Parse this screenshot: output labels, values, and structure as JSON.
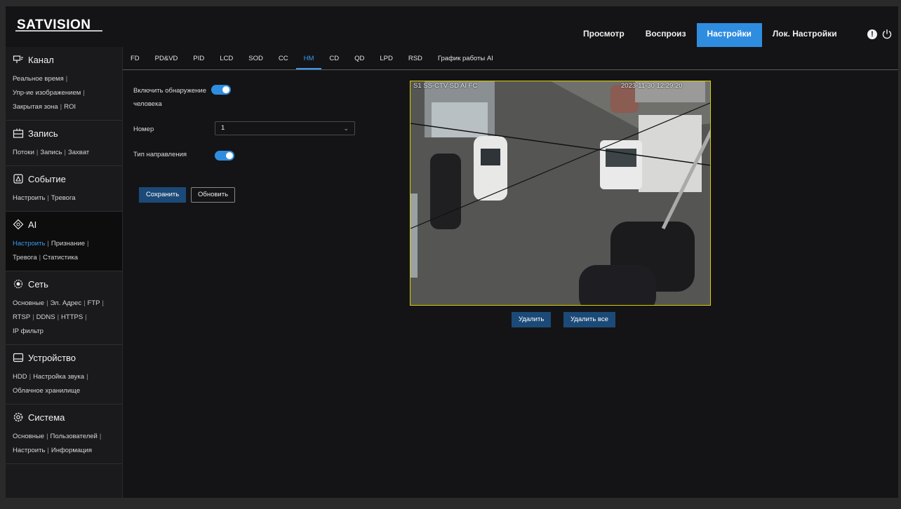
{
  "header": {
    "logo_text": "SATVISION",
    "nav": [
      {
        "label": "Просмотр",
        "active": false
      },
      {
        "label": "Воспроиз",
        "active": false
      },
      {
        "label": "Настройки",
        "active": true
      },
      {
        "label": "Лок. Настройки",
        "active": false
      }
    ],
    "alert_glyph": "!"
  },
  "sidebar": {
    "sections": [
      {
        "title": "Канал",
        "icon": "channel-icon",
        "lines": [
          [
            "Реальное время"
          ],
          [
            "Упр-ие изображением"
          ],
          [
            "Закрытая зона",
            "ROI"
          ]
        ]
      },
      {
        "title": "Запись",
        "icon": "record-icon",
        "lines": [
          [
            "Потоки",
            "Запись",
            "Захват"
          ]
        ]
      },
      {
        "title": "Событие",
        "icon": "event-icon",
        "lines": [
          [
            "Настроить",
            "Тревога"
          ]
        ]
      },
      {
        "title": "AI",
        "icon": "ai-icon",
        "lines": [
          [
            "Настроить",
            "Признание"
          ],
          [
            "Тревога",
            "Статистика"
          ]
        ]
      },
      {
        "title": "Сеть",
        "icon": "network-icon",
        "lines": [
          [
            "Основные",
            "Эл. Адрес",
            "FTP"
          ],
          [
            "RTSP",
            "DDNS",
            "HTTPS"
          ],
          [
            "IP фильтр"
          ]
        ]
      },
      {
        "title": "Устройство",
        "icon": "device-icon",
        "lines": [
          [
            "HDD",
            "Настройка звука"
          ],
          [
            "Облачное хранилище"
          ]
        ]
      },
      {
        "title": "Система",
        "icon": "system-icon",
        "lines": [
          [
            "Основные",
            "Пользователей"
          ],
          [
            "Настроить",
            "Информация"
          ]
        ]
      }
    ]
  },
  "tabs": [
    "FD",
    "PD&VD",
    "PID",
    "LCD",
    "SOD",
    "CC",
    "HM",
    "CD",
    "QD",
    "LPD",
    "RSD",
    "График работы AI"
  ],
  "active_tab": "HM",
  "form": {
    "enable_label_line1": "Включить обнаружение",
    "enable_label_line2": "человека",
    "enable_on": true,
    "number_label": "Номер",
    "number_value": "1",
    "direction_label": "Тип направления",
    "direction_on": true,
    "save_label": "Сохранить",
    "refresh_label": "Обновить"
  },
  "video": {
    "osd_left": "S1 SS-CTV SD AI FC",
    "osd_right": "2023-11-30 12:29:20",
    "delete_label": "Удалить",
    "delete_all_label": "Удалить все"
  },
  "colors": {
    "accent": "#2f8de0",
    "active_link": "#3a9af0",
    "frame": "#d8d000"
  }
}
